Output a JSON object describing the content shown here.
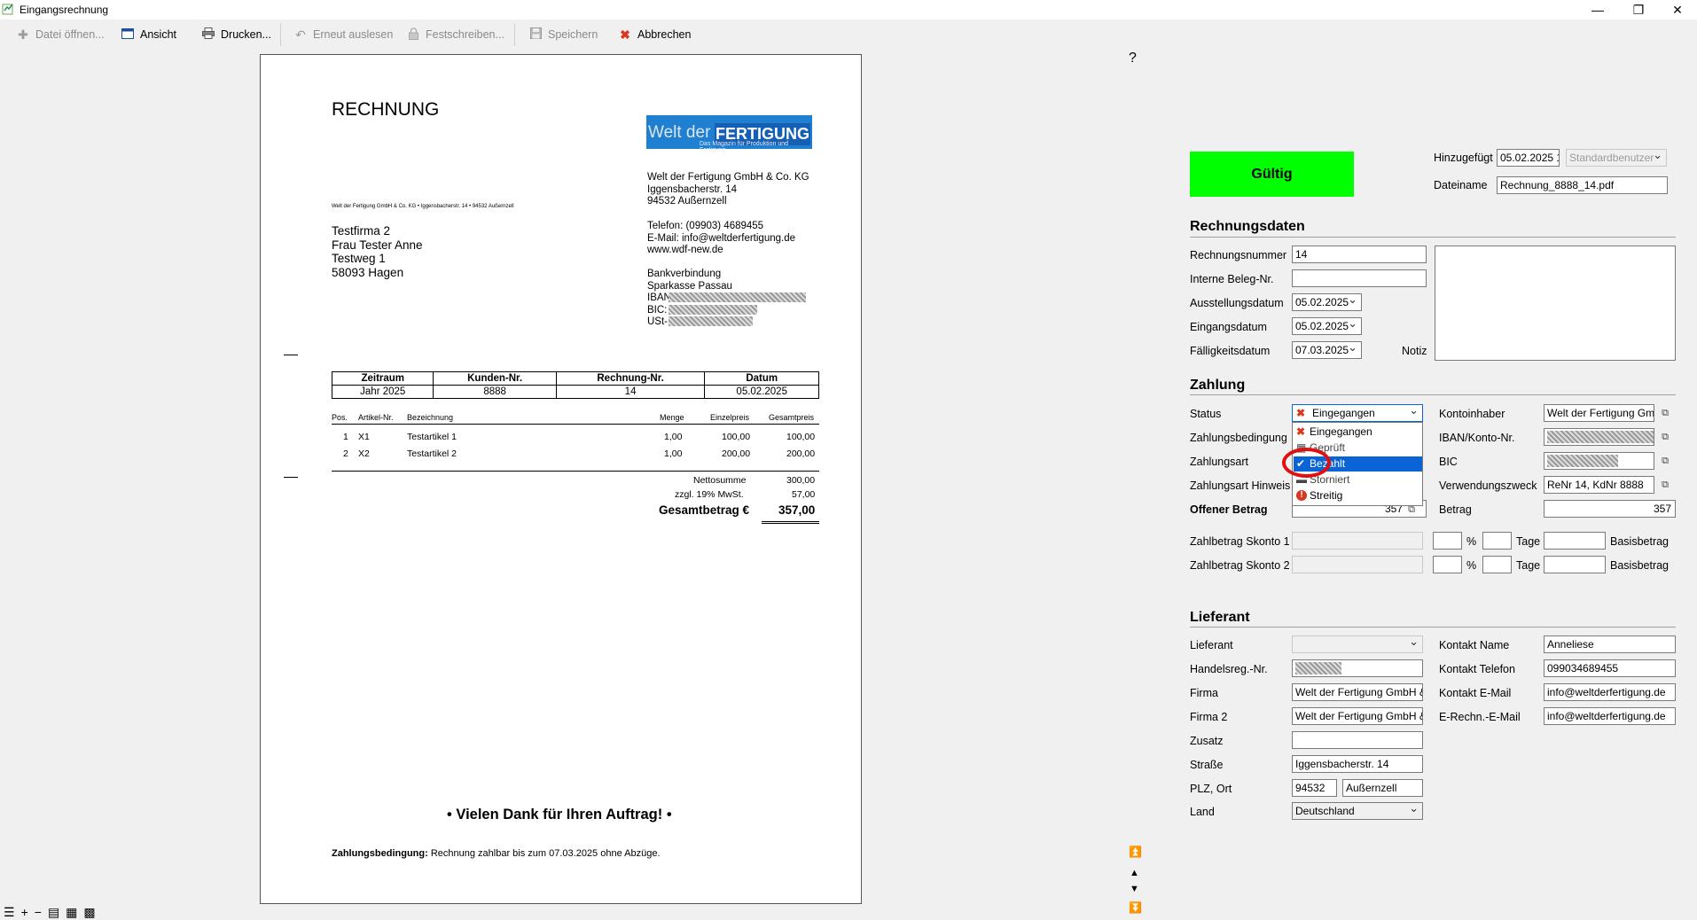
{
  "window": {
    "title": "Eingangsrechnung",
    "minimize": "—",
    "restore": "❐",
    "close": "✕"
  },
  "toolbar": {
    "open": "Datei öffnen...",
    "view": "Ansicht",
    "print": "Drucken...",
    "reread": "Erneut auslesen",
    "lock": "Festschreiben...",
    "save": "Speichern",
    "cancel": "Abbrechen"
  },
  "help": "?",
  "invoice": {
    "heading": "RECHNUNG",
    "logo": {
      "word1": "Welt der",
      "word2": "FERTIGUNG",
      "tag": "Das Magazin für Produktion und Fertigung"
    },
    "sender_line": "Welt der Fertigung GmbH & Co. KG • Iggensbacherstr. 14 • 94532 Außernzell",
    "recipient": [
      "Testfirma 2",
      "Frau Tester Anne",
      "Testweg 1",
      "58093 Hagen"
    ],
    "company": [
      "Welt der Fertigung GmbH & Co. KG",
      "Iggensbacherstr. 14",
      "94532 Außernzell"
    ],
    "contact": [
      "Telefon: (09903) 4689455",
      "E-Mail: info@weltderfertigung.de",
      "www.wdf-new.de"
    ],
    "bank": [
      "Bankverbindung",
      "Sparkasse Passau",
      "IBAN:",
      "BIC:",
      "USt-"
    ],
    "meta_headers": [
      "Zeitraum",
      "Kunden-Nr.",
      "Rechnung-Nr.",
      "Datum"
    ],
    "meta_values": [
      "Jahr 2025",
      "8888",
      "14",
      "05.02.2025"
    ],
    "item_headers": [
      "Pos.",
      "Artikel-Nr.",
      "Bezeichnung",
      "Menge",
      "Einzelpreis",
      "Gesamtpreis"
    ],
    "items": [
      [
        "1",
        "X1",
        "Testartikel 1",
        "1,00",
        "100,00",
        "100,00"
      ],
      [
        "2",
        "X2",
        "Testartikel 2",
        "1,00",
        "200,00",
        "200,00"
      ]
    ],
    "net_label": "Nettosumme",
    "net_value": "300,00",
    "vat_label": "zzgl. 19% MwSt.",
    "vat_value": "57,00",
    "total_label": "Gesamtbetrag €",
    "total_value": "357,00",
    "thanks": "• Vielen Dank für Ihren Auftrag! •",
    "terms_bold": "Zahlungsbedingung:",
    "terms": " Rechnung zahlbar bis zum 07.03.2025 ohne Abzüge."
  },
  "doc_nav": {
    "first": "⏫",
    "up": "▲",
    "down": "▼",
    "last": "⏬"
  },
  "zoom_bar": {
    "menu": "☰",
    "plus": "+",
    "minus": "−",
    "page": "▤",
    "two": "▦",
    "grid": "▩"
  },
  "status_button": {
    "label": "Gültig",
    "color": "#00ff00"
  },
  "header_fields": {
    "added_label": "Hinzugefügt",
    "added_value": "05.02.2025 1",
    "user_value": "Standardbenutzer",
    "filename_label": "Dateiname",
    "filename_value": "Rechnung_8888_14.pdf"
  },
  "rechnungsdaten": {
    "title": "Rechnungsdaten",
    "nr_label": "Rechnungsnummer",
    "nr_value": "14",
    "beleg_label": "Interne Beleg-Nr.",
    "beleg_value": "",
    "ausst_label": "Ausstellungsdatum",
    "ausst_value": "05.02.2025",
    "eing_label": "Eingangsdatum",
    "eing_value": "05.02.2025",
    "faell_label": "Fälligkeitsdatum",
    "faell_value": "07.03.2025",
    "notiz_label": "Notiz"
  },
  "zahlung": {
    "title": "Zahlung",
    "status_label": "Status",
    "status_value": "Eingegangen",
    "bedingung_label": "Zahlungsbedingung",
    "art_label": "Zahlungsart",
    "hinweis_label": "Zahlungsart Hinweis",
    "offen_label": "Offener Betrag",
    "offen_value": "357",
    "inhaber_label": "Kontoinhaber",
    "inhaber_value": "Welt der Fertigung Gm",
    "iban_label": "IBAN/Konto-Nr.",
    "bic_label": "BIC",
    "zweck_label": "Verwendungszweck",
    "zweck_value": "ReNr 14, KdNr 8888",
    "betrag_label": "Betrag",
    "betrag_value": "357",
    "skonto1_label": "Zahlbetrag Skonto 1",
    "skonto2_label": "Zahlbetrag Skonto 2",
    "percent": "%",
    "tage": "Tage",
    "basis": "Basisbetrag",
    "status_options": [
      {
        "label": "Eingegangen",
        "icon": "✖",
        "color": "#d9381e"
      },
      {
        "label": "Geprüft",
        "icon": "▦",
        "color": "#555"
      },
      {
        "label": "Bezahlt",
        "icon": "✔",
        "color": "#fff"
      },
      {
        "label": "Storniert",
        "icon": "▬",
        "color": "#555"
      },
      {
        "label": "Streitig",
        "icon": "!",
        "color": "#fff"
      }
    ]
  },
  "lieferant": {
    "title": "Lieferant",
    "lieferant_label": "Lieferant",
    "hreg_label": "Handelsreg.-Nr.",
    "firma_label": "Firma",
    "firma_value": "Welt der Fertigung GmbH &",
    "firma2_label": "Firma 2",
    "firma2_value": "Welt der Fertigung GmbH &",
    "zusatz_label": "Zusatz",
    "strasse_label": "Straße",
    "strasse_value": "Iggensbacherstr. 14",
    "plz_label": "PLZ, Ort",
    "plz_value": "94532",
    "ort_value": "Außernzell",
    "land_label": "Land",
    "land_value": "Deutschland",
    "kname_label": "Kontakt Name",
    "kname_value": "Anneliese",
    "ktel_label": "Kontakt Telefon",
    "ktel_value": "099034689455",
    "kmail_label": "Kontakt E-Mail",
    "kmail_value": "info@weltderfertigung.de",
    "emails_label": "E-Rechn.-E-Mail",
    "emails_value": "info@weltderfertigung.de"
  },
  "colors": {
    "accent": "#0a64d6",
    "valid": "#00ff00",
    "highlight_ring": "#e01010"
  }
}
